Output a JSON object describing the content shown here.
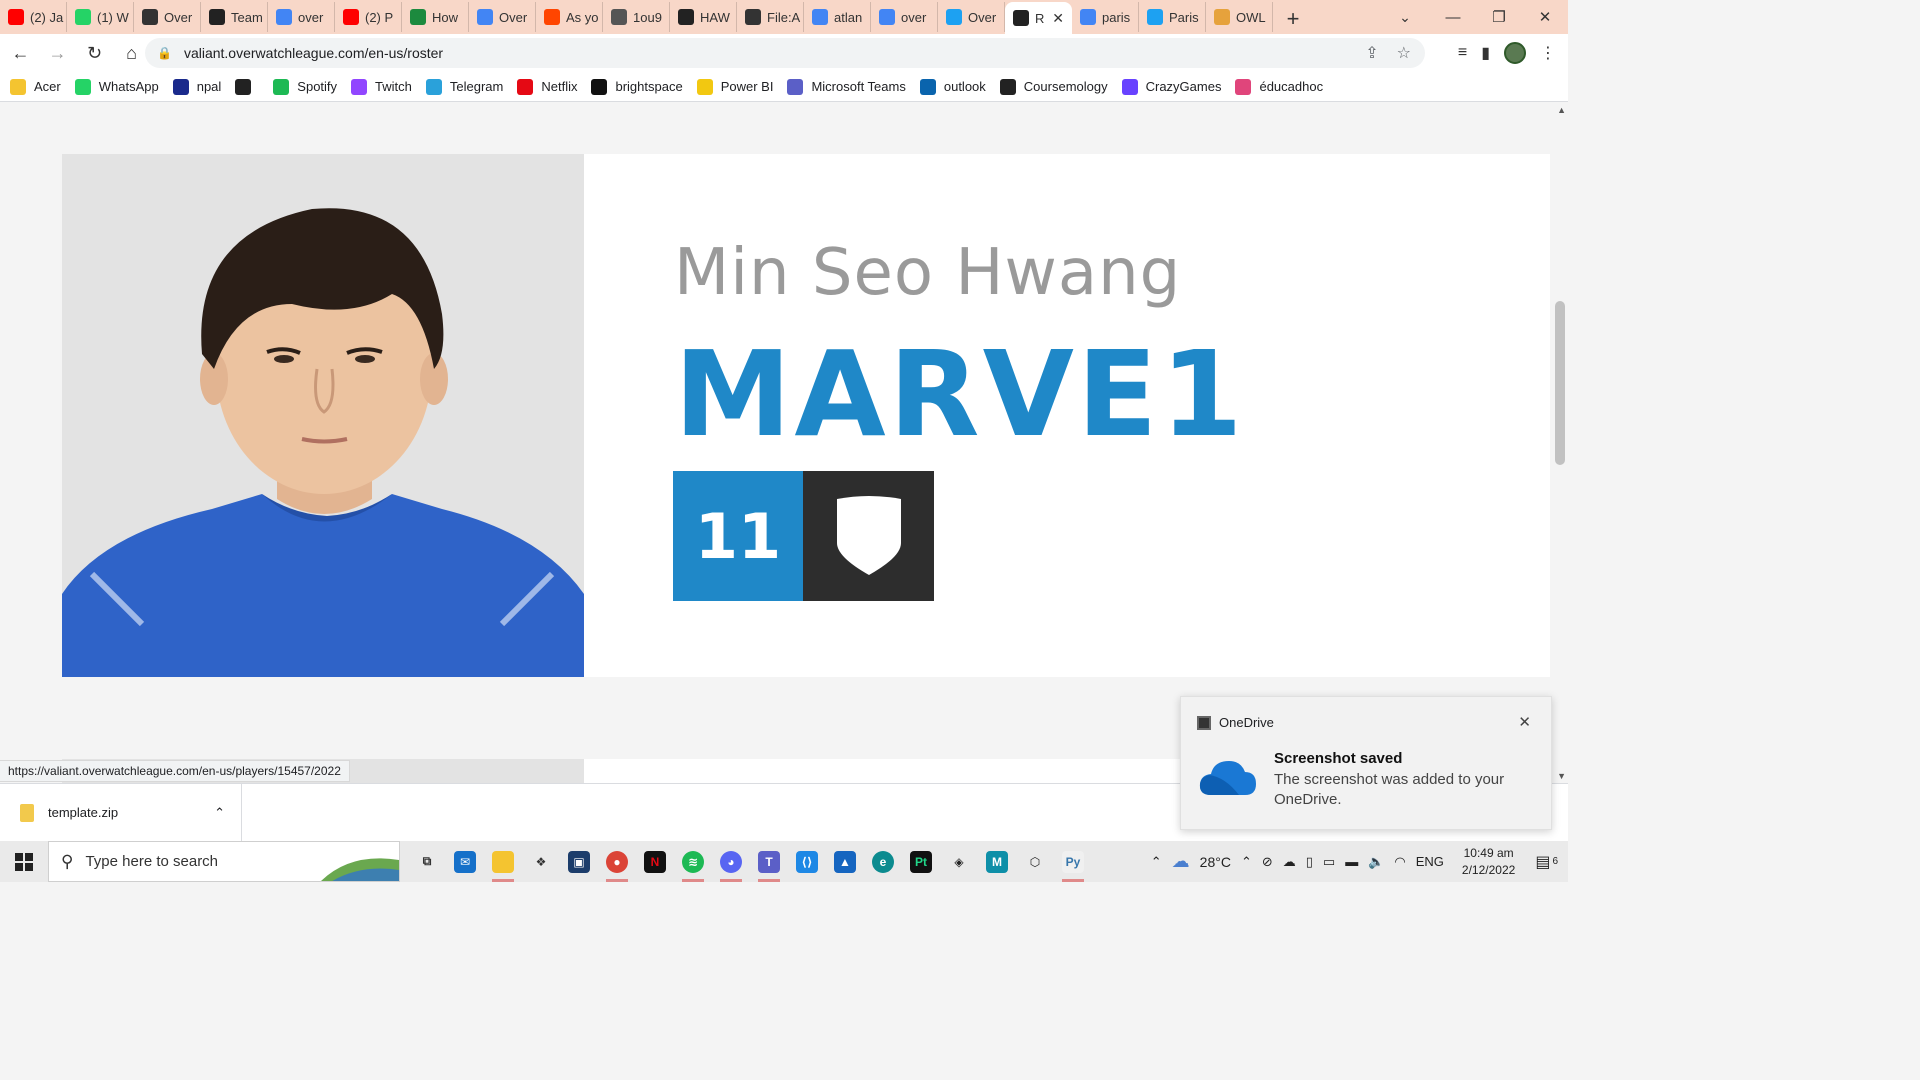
{
  "browser": {
    "tabs": [
      {
        "label": "(2) Ja",
        "icon": "youtube-icon",
        "color": "#ff0000"
      },
      {
        "label": "(1) W",
        "icon": "whatsapp-icon",
        "color": "#25d366"
      },
      {
        "label": "Over",
        "icon": "overwatch-icon",
        "color": "#333333"
      },
      {
        "label": "Team",
        "icon": "site-icon",
        "color": "#222222"
      },
      {
        "label": "over",
        "icon": "google-icon",
        "color": "#4285f4"
      },
      {
        "label": "(2) P",
        "icon": "youtube-icon",
        "color": "#ff0000"
      },
      {
        "label": "How",
        "icon": "wikihow-icon",
        "color": "#1c8a3e"
      },
      {
        "label": "Over",
        "icon": "google-icon",
        "color": "#4285f4"
      },
      {
        "label": "As yo",
        "icon": "reddit-icon",
        "color": "#ff4500"
      },
      {
        "label": "1ou9",
        "icon": "globe-icon",
        "color": "#555555"
      },
      {
        "label": "HAW",
        "icon": "site-icon",
        "color": "#222222"
      },
      {
        "label": "File:A",
        "icon": "wiki-icon",
        "color": "#333333"
      },
      {
        "label": "atlan",
        "icon": "google-icon",
        "color": "#4285f4"
      },
      {
        "label": "over",
        "icon": "google-icon",
        "color": "#4285f4"
      },
      {
        "label": "Over",
        "icon": "twitter-icon",
        "color": "#1da1f2"
      },
      {
        "label": "R",
        "icon": "site-icon",
        "color": "#222222",
        "active": true
      },
      {
        "label": "paris",
        "icon": "google-icon",
        "color": "#4285f4"
      },
      {
        "label": "Paris",
        "icon": "twitter-icon",
        "color": "#1da1f2"
      },
      {
        "label": "OWL",
        "icon": "owl-icon",
        "color": "#e6a23c"
      }
    ],
    "url": "valiant.overwatchleague.com/en-us/roster",
    "bookmarks": [
      {
        "label": "Acer",
        "icon": "folder-icon",
        "color": "#f4c430"
      },
      {
        "label": "WhatsApp",
        "icon": "whatsapp-icon",
        "color": "#25d366"
      },
      {
        "label": "npal",
        "icon": "npal-icon",
        "color": "#1a2a8c"
      },
      {
        "label": "",
        "icon": "globe-icon",
        "color": "#222222"
      },
      {
        "label": "Spotify",
        "icon": "spotify-icon",
        "color": "#1db954"
      },
      {
        "label": "Twitch",
        "icon": "twitch-icon",
        "color": "#9146ff"
      },
      {
        "label": "Telegram",
        "icon": "telegram-icon",
        "color": "#2aa1da"
      },
      {
        "label": "Netflix",
        "icon": "netflix-icon",
        "color": "#e50914"
      },
      {
        "label": "brightspace",
        "icon": "np-icon",
        "color": "#111111"
      },
      {
        "label": "Power BI",
        "icon": "powerbi-icon",
        "color": "#f2c811"
      },
      {
        "label": "Microsoft Teams",
        "icon": "teams-icon",
        "color": "#5b5fc7"
      },
      {
        "label": "outlook",
        "icon": "outlook-icon",
        "color": "#0a64ad"
      },
      {
        "label": "Coursemology",
        "icon": "coursemology-icon",
        "color": "#222222"
      },
      {
        "label": "CrazyGames",
        "icon": "crazygames-icon",
        "color": "#6842ff"
      },
      {
        "label": "éducadhoc",
        "icon": "educadhoc-icon",
        "color": "#e0457b"
      }
    ],
    "status_url": "https://valiant.overwatchleague.com/en-us/players/15457/2022"
  },
  "player": {
    "full_name": "Min Seo Hwang",
    "handle": "MARVE1",
    "number": "11",
    "role_icon": "shield-icon",
    "accent_color": "#1f88c8"
  },
  "downloads": {
    "file": "template.zip"
  },
  "toast": {
    "app": "OneDrive",
    "title": "Screenshot saved",
    "body": "The screenshot was added to your OneDrive."
  },
  "taskbar": {
    "search_placeholder": "Type here to search",
    "weather": "28°C",
    "language": "ENG",
    "time": "10:49 am",
    "date": "2/12/2022",
    "notification_count": "6"
  }
}
